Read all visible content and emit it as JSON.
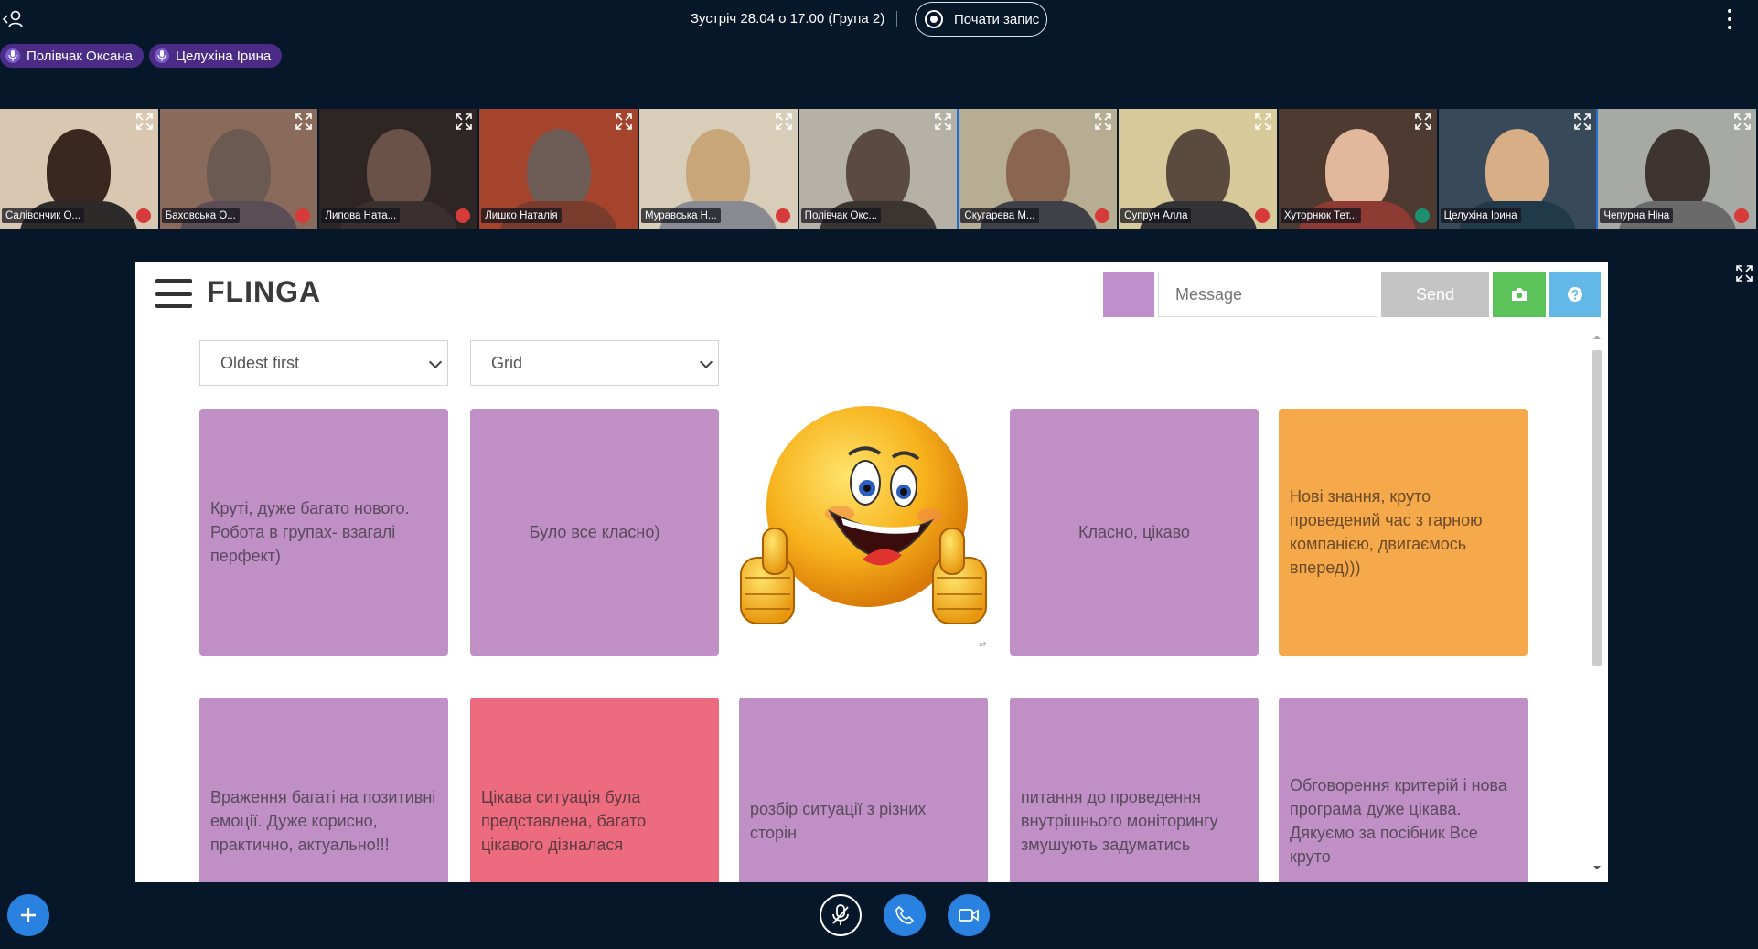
{
  "topbar": {
    "meeting_title": "Зустріч 28.04 о 17.00 (Група 2)",
    "record_label": "Почати запис"
  },
  "talkers": [
    {
      "name": "Полівчак Оксана"
    },
    {
      "name": "Целухіна Ірина"
    }
  ],
  "participants": [
    {
      "name": "Салівончик О...",
      "bg": "#d9c7b1",
      "head": "#3a2820",
      "body": "#2d2a2a",
      "mic": "muted"
    },
    {
      "name": "Баховська О...",
      "bg": "#8a6a5a",
      "head": "#6b5a52",
      "body": "#5a4d55",
      "mic": "muted"
    },
    {
      "name": "Липова Ната...",
      "bg": "#2e2624",
      "head": "#6a5248",
      "body": "#3b3030",
      "mic": "muted"
    },
    {
      "name": "Лишко Наталія",
      "bg": "#a5442d",
      "head": "#6d5d56",
      "body": "#7a3c2c",
      "mic": "none"
    },
    {
      "name": "Муравська Н...",
      "bg": "#d8cdb8",
      "head": "#c8a67a",
      "body": "#8a8a92",
      "mic": "muted"
    },
    {
      "name": "Полівчак Окс...",
      "bg": "#b6b1a6",
      "head": "#5b4a40",
      "body": "#3a3530",
      "mic": "none"
    },
    {
      "name": "Скугарева М...",
      "bg": "#b7ad92",
      "head": "#8a6650",
      "body": "#404048",
      "mic": "muted"
    },
    {
      "name": "Супрун Алла",
      "bg": "#d7c99a",
      "head": "#5b4a3e",
      "body": "#333336",
      "mic": "muted"
    },
    {
      "name": "Хуторнюк Тет...",
      "bg": "#4e3a30",
      "head": "#e2b89c",
      "body": "#8e3b33",
      "mic": "listen"
    },
    {
      "name": "Целухіна Ірина",
      "bg": "#384a5a",
      "head": "#d8ae86",
      "body": "#203a4a",
      "mic": "none"
    },
    {
      "name": "Чепурна Ніна",
      "bg": "#a7a9a4",
      "head": "#3d3330",
      "body": "#6b6a6b",
      "mic": "muted"
    }
  ],
  "flinga": {
    "logo": "FLINGA",
    "message_placeholder": "Message",
    "send_label": "Send",
    "sort_value": "Oldest first",
    "view_value": "Grid",
    "colors": {
      "purple": "#bf8fc5",
      "orange": "#f6a94a",
      "red": "#ec6b7e",
      "send": "#c4c4c4",
      "camera": "#5cc35b",
      "help": "#62b9e8"
    },
    "cards_row1": [
      "Круті, дуже багато нового. Робота в групах- взагалі перфект)",
      "Було все класно)",
      "Класно, цікаво",
      "Нові знання, круто проведений час з гарною компанією, двигаємось вперед)))"
    ],
    "cards_row2": [
      "Враження багаті на позитивні емоції. Дуже корисно, практично, актуально!!!",
      "Цікава ситуація була представлена, багато цікавого дізналася",
      "розбір ситуації з різних сторін",
      "питання до проведення внутрішнього моніторингу змушують задуматись",
      "Обговорення критерій і нова програма дуже цікава. Дякуємо за посібник Все круто"
    ]
  }
}
